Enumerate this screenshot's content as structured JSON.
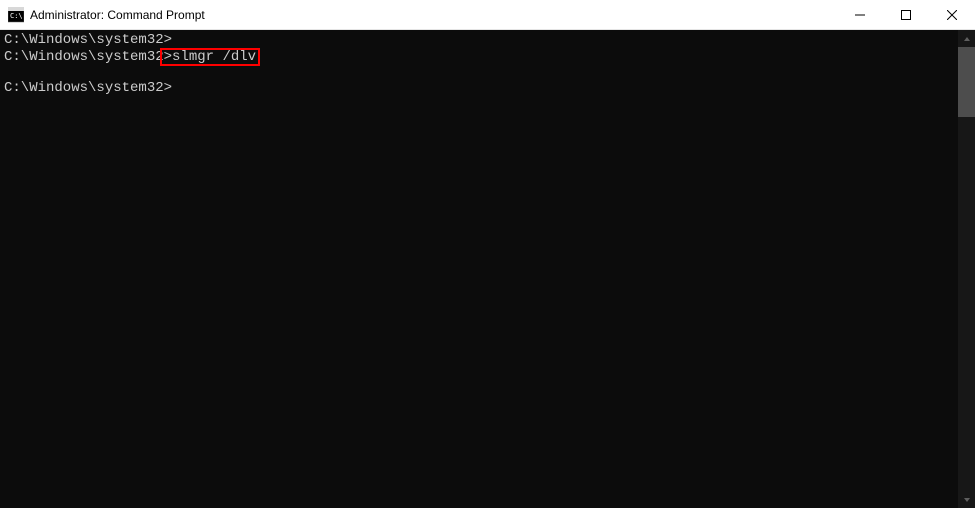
{
  "window": {
    "title": "Administrator: Command Prompt"
  },
  "console": {
    "lines": [
      {
        "prompt": "C:\\Windows\\system32>",
        "command": "",
        "highlighted": false
      },
      {
        "prompt": "C:\\Windows\\system32",
        "command": ">slmgr /dlv",
        "highlighted": true
      },
      {
        "prompt": "",
        "command": "",
        "highlighted": false
      },
      {
        "prompt": "C:\\Windows\\system32>",
        "command": "",
        "highlighted": false
      }
    ]
  }
}
